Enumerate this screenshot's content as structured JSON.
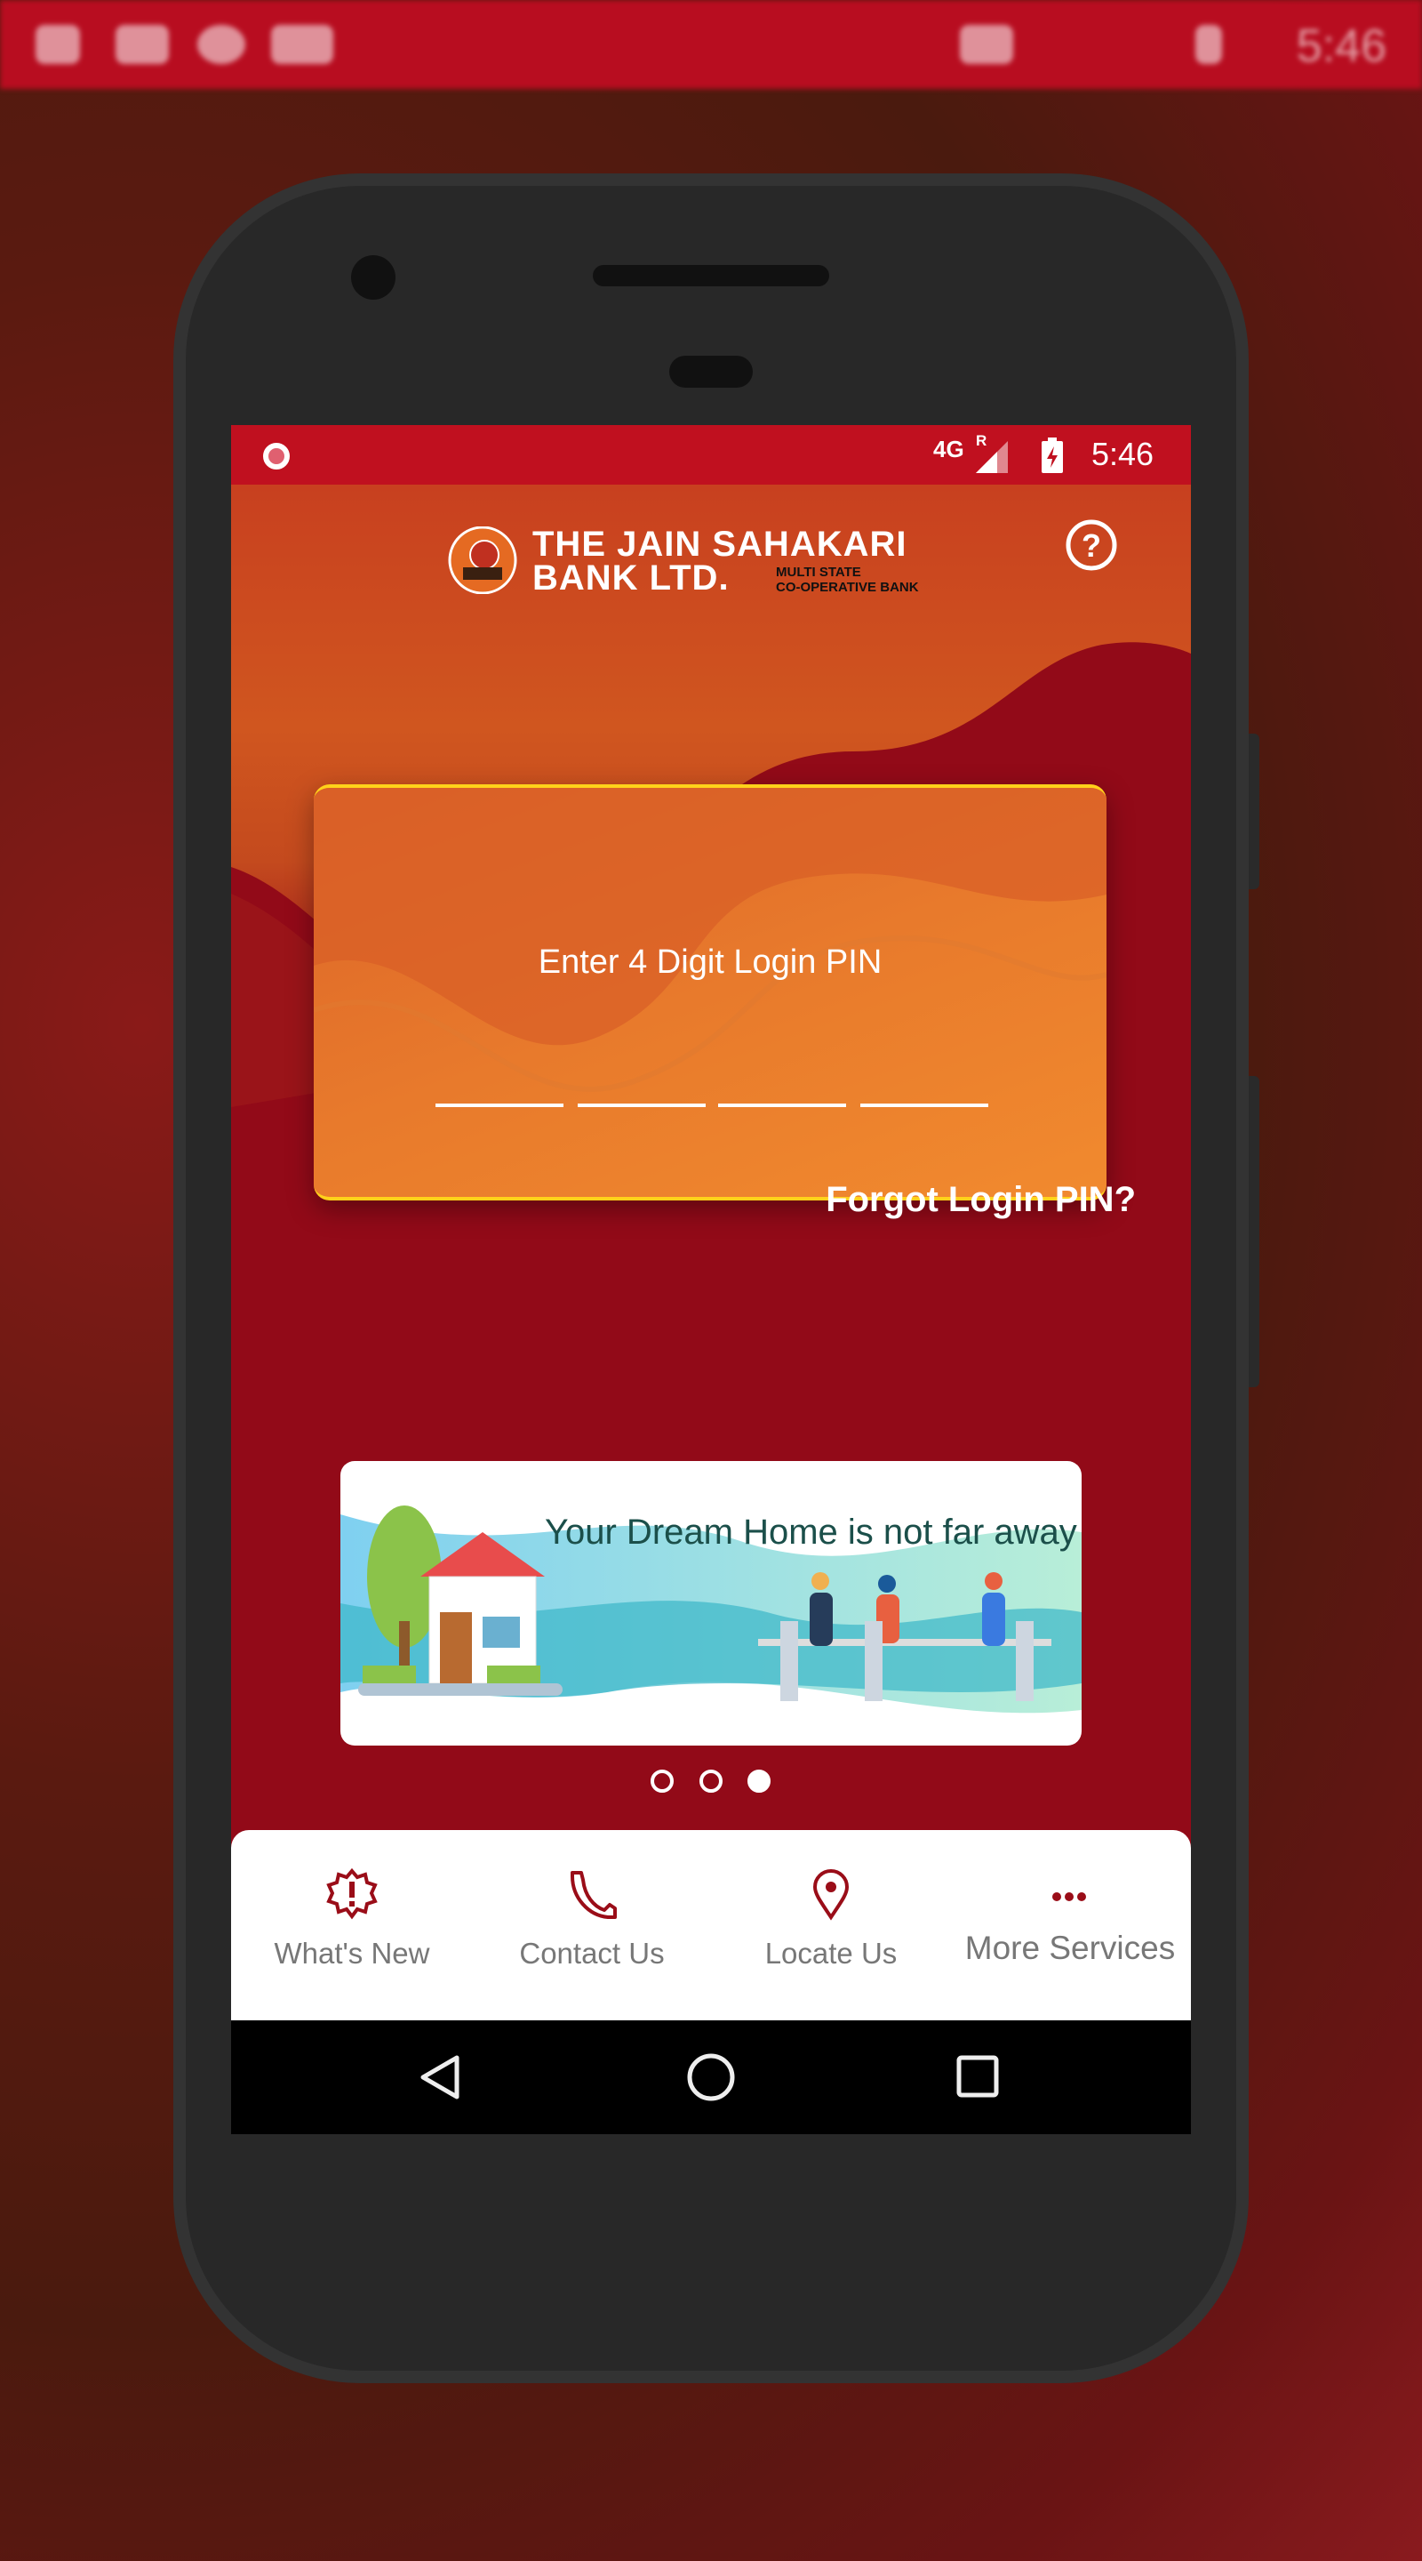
{
  "outer_status": {
    "time": "5:46"
  },
  "status_bar": {
    "network": "4G",
    "roaming": "R",
    "time": "5:46"
  },
  "header": {
    "logo_line1": "THE JAIN SAHAKARI",
    "logo_line2": "BANK LTD.",
    "logo_sub1": "MULTI STATE",
    "logo_sub2": "CO-OPERATIVE BANK",
    "help_icon": "question-circle-icon"
  },
  "login": {
    "prompt": "Enter 4 Digit Login PIN",
    "pin_digits": 4,
    "forgot_label": "Forgot Login PIN?"
  },
  "banner": {
    "text": "Your Dream Home is not far away",
    "slides": 3,
    "active_slide": 3
  },
  "bottom_nav": {
    "items": [
      {
        "label": "What's New",
        "icon": "alert-badge-icon"
      },
      {
        "label": "Contact Us",
        "icon": "phone-icon"
      },
      {
        "label": "Locate Us",
        "icon": "map-pin-icon"
      },
      {
        "label": "More Services",
        "icon": "more-dots-icon"
      }
    ]
  },
  "colors": {
    "primary": "#920a18",
    "accent": "#f0892c",
    "status": "#c0101f",
    "icon": "#9a0d18"
  }
}
